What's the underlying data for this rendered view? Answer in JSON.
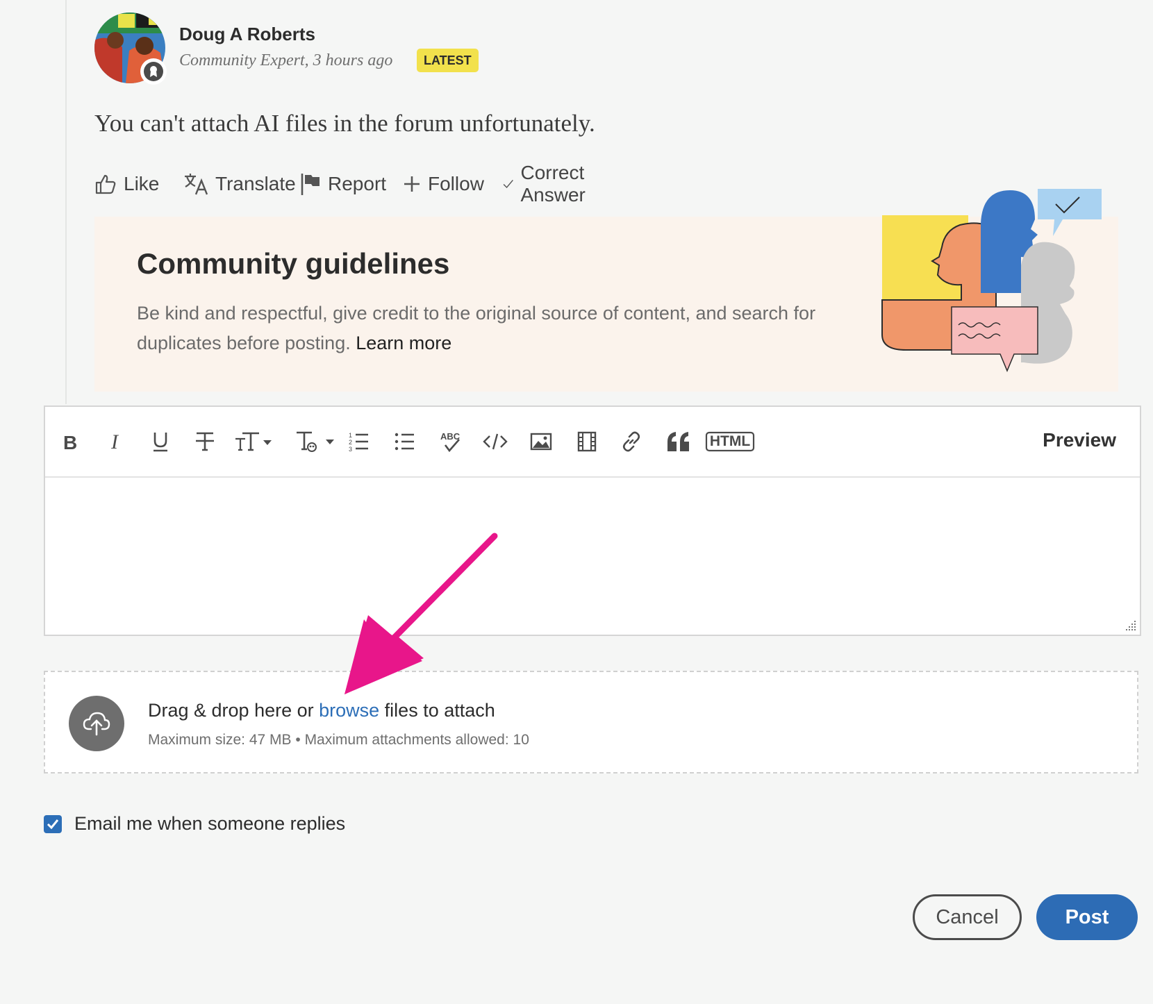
{
  "post": {
    "author_name": "Doug A Roberts",
    "author_meta": "Community Expert, 3 hours ago",
    "badge": "LATEST",
    "body": "You can't attach AI files in the forum unfortunately.",
    "avatar_icon": "avatar-photo",
    "expert_icon": "expert-badge-icon"
  },
  "actions": {
    "like": "Like",
    "translate": "Translate",
    "report": "Report",
    "follow": "Follow",
    "correct_answer": "Correct Answer"
  },
  "guidelines": {
    "title": "Community guidelines",
    "text": "Be kind and respectful, give credit to the original source of content, and search for duplicates before posting.",
    "link": "Learn more"
  },
  "editor": {
    "toolbar": [
      "bold",
      "italic",
      "underline",
      "strikethrough",
      "font-size",
      "text-style",
      "numbered-list",
      "bulleted-list",
      "spellcheck",
      "code",
      "image",
      "video",
      "link",
      "quote",
      "html"
    ],
    "html_label": "HTML",
    "preview_label": "Preview",
    "content": ""
  },
  "attach": {
    "prefix": "Drag & drop here or ",
    "browse": "browse",
    "suffix": " files to attach",
    "limits": "Maximum size: 47 MB • Maximum attachments allowed: 10"
  },
  "email_opt": {
    "label": "Email me when someone replies",
    "checked": true
  },
  "buttons": {
    "cancel": "Cancel",
    "post": "Post"
  },
  "colors": {
    "accent": "#2d6cb5",
    "badge": "#f2e14c",
    "guidelines_bg": "#fbf3ec",
    "annotation_arrow": "#e8168a"
  }
}
